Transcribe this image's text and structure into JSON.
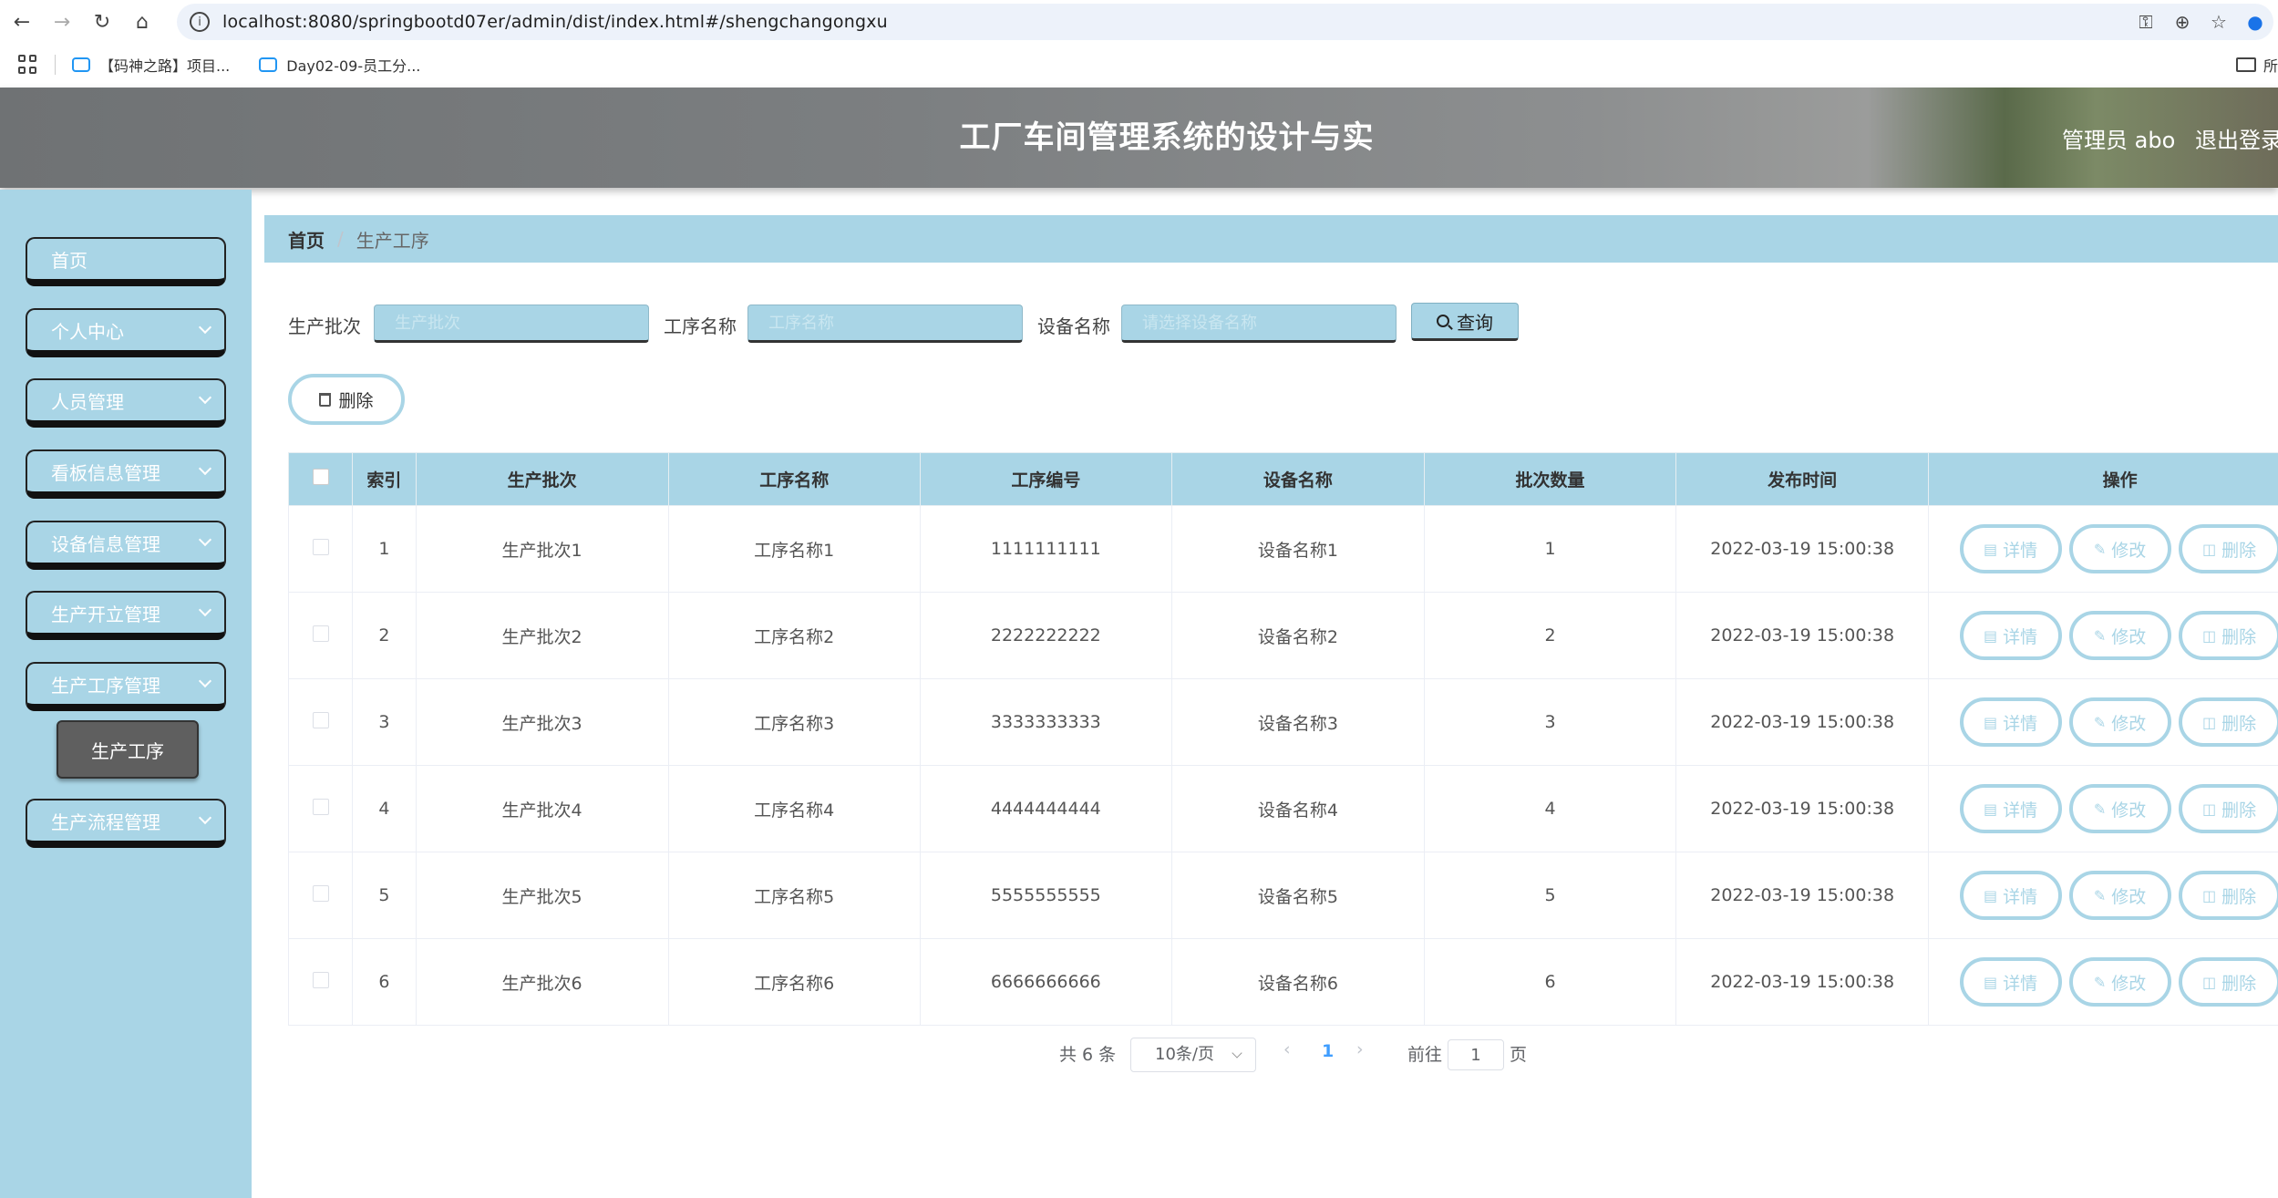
{
  "browser": {
    "url": "localhost:8080/springbootd07er/admin/dist/index.html#/shengchangongxu",
    "bookmarks": [
      "【码神之路】项目...",
      "Day02-09-员工分..."
    ],
    "bookmark_right": "所"
  },
  "header": {
    "title": "工厂车间管理系统的设计与实",
    "user": "管理员 abo",
    "logout": "退出登录"
  },
  "sidebar": {
    "items": [
      {
        "label": "首页"
      },
      {
        "label": "个人中心"
      },
      {
        "label": "人员管理"
      },
      {
        "label": "看板信息管理"
      },
      {
        "label": "设备信息管理"
      },
      {
        "label": "生产开立管理"
      },
      {
        "label": "生产工序管理"
      },
      {
        "label": "生产流程管理"
      }
    ],
    "active_sub": "生产工序"
  },
  "breadcrumb": {
    "home": "首页",
    "separator": "/",
    "current": "生产工序"
  },
  "search": {
    "batch_label": "生产批次",
    "batch_placeholder": "生产批次",
    "process_label": "工序名称",
    "process_placeholder": "工序名称",
    "device_label": "设备名称",
    "device_placeholder": "请选择设备名称",
    "query_label": "查询"
  },
  "toolbar": {
    "delete_label": "删除"
  },
  "table": {
    "headers": [
      "索引",
      "生产批次",
      "工序名称",
      "工序编号",
      "设备名称",
      "批次数量",
      "发布时间",
      "操作"
    ],
    "rows": [
      [
        "1",
        "生产批次1",
        "工序名称1",
        "1111111111",
        "设备名称1",
        "1",
        "2022-03-19 15:00:38"
      ],
      [
        "2",
        "生产批次2",
        "工序名称2",
        "2222222222",
        "设备名称2",
        "2",
        "2022-03-19 15:00:38"
      ],
      [
        "3",
        "生产批次3",
        "工序名称3",
        "3333333333",
        "设备名称3",
        "3",
        "2022-03-19 15:00:38"
      ],
      [
        "4",
        "生产批次4",
        "工序名称4",
        "4444444444",
        "设备名称4",
        "4",
        "2022-03-19 15:00:38"
      ],
      [
        "5",
        "生产批次5",
        "工序名称5",
        "5555555555",
        "设备名称5",
        "5",
        "2022-03-19 15:00:38"
      ],
      [
        "6",
        "生产批次6",
        "工序名称6",
        "6666666666",
        "设备名称6",
        "6",
        "2022-03-19 15:00:38"
      ]
    ],
    "actions": {
      "detail": "详情",
      "edit": "修改",
      "delete": "删除"
    }
  },
  "pagination": {
    "total": "共 6 条",
    "page_size": "10条/页",
    "current_page": "1",
    "goto": "前往",
    "goto_value": "1",
    "page_suffix": "页"
  },
  "colors": {
    "accent": "#a9d5e6",
    "header_bg": "#7c7f81",
    "active_sub": "#5f5f5f"
  }
}
